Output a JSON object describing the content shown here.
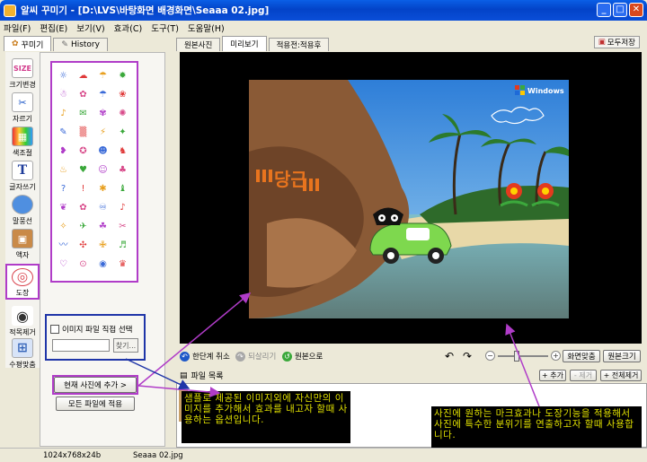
{
  "window": {
    "title": "알씨 꾸미기 - [D:\\LVS\\바탕화면 배경화면\\Seaaa 02.jpg]",
    "minimize_glyph": "_",
    "maximize_glyph": "□",
    "close_glyph": "✕"
  },
  "menu": [
    "파일(F)",
    "편집(E)",
    "보기(V)",
    "효과(C)",
    "도구(T)",
    "도움말(H)"
  ],
  "left_tabs": [
    {
      "label": "꾸미기",
      "icon": "decorate-icon"
    },
    {
      "label": "History",
      "icon": "history-icon"
    }
  ],
  "tools": [
    {
      "label": "크기변경",
      "icon": "resize-icon",
      "glyph": "SIZE"
    },
    {
      "label": "자르기",
      "icon": "crop-icon",
      "glyph": "✂"
    },
    {
      "label": "색조절",
      "icon": "color-adjust-icon",
      "glyph": "▦"
    },
    {
      "label": "글자쓰기",
      "icon": "text-icon",
      "glyph": "T"
    },
    {
      "label": "말풍선",
      "icon": "speech-bubble-icon",
      "glyph": "💬"
    },
    {
      "label": "액자",
      "icon": "frame-icon",
      "glyph": "▣"
    },
    {
      "label": "도장",
      "icon": "stamp-icon",
      "glyph": "◎"
    },
    {
      "label": "적목제거",
      "icon": "red-eye-icon",
      "glyph": "◉"
    },
    {
      "label": "수평맞춤",
      "icon": "level-icon",
      "glyph": "⊞"
    }
  ],
  "stickers": [
    "☼",
    "☁",
    "☂",
    "✹",
    "☃",
    "✿",
    "☂",
    "❀",
    "♪",
    "✉",
    "✾",
    "✺",
    "✎",
    "▒",
    "⚡",
    "✦",
    "❥",
    "✪",
    "☻",
    "♞",
    "♨",
    "♥",
    "☺",
    "♣",
    "?",
    "!",
    "✱",
    "♝",
    "❦",
    "✿",
    "♾",
    "♪",
    "✧",
    "✈",
    "☘",
    "✂",
    "〰",
    "✣",
    "✙",
    "♬",
    "♡",
    "⊙",
    "◉",
    "♛"
  ],
  "image_select": {
    "checkbox_label": "이미지 파일 직접 선택",
    "find_button": "찾기..."
  },
  "buttons": {
    "add_to_current": "현재 사진에 추가 >",
    "apply_all": "모든 파일에 적용"
  },
  "right_tabs": [
    "원본사진",
    "미리보기",
    "적용전:적용후"
  ],
  "save_all": "모두저장",
  "photo": {
    "windows_logo": "Windows",
    "sticker_text": "당근"
  },
  "controls": {
    "undo_step": "한단계 취소",
    "redo": "되살리기",
    "original": "원본으로",
    "fit_screen": "화면맞춤",
    "original_size": "원본크기",
    "rotate_left_glyph": "↶",
    "rotate_right_glyph": "↷",
    "zoom_out_glyph": "−",
    "zoom_in_glyph": "+"
  },
  "file_list": {
    "title": "파일 목록",
    "add": "+ 추가",
    "remove": "- 제거",
    "remove_all": "+ 전체제거"
  },
  "status": {
    "resolution": "1024x768x24b",
    "filename": "Seaaa 02.jpg"
  },
  "notes": {
    "left": "샘플로 제공된 이미지외에 자신만의 이미지를 추가해서 효과를 내고자 할때 사용하는 옵션입니다.",
    "right": "사진에 원하는 마크효과나 도장기능을 적용해서 사진에 특수한 분위기를 연출하고자 할때 사용합니다."
  },
  "colors": {
    "annotation_magenta": "#B03CC8",
    "annotation_blue": "#1F35A8",
    "note_text": "#E0E000"
  }
}
